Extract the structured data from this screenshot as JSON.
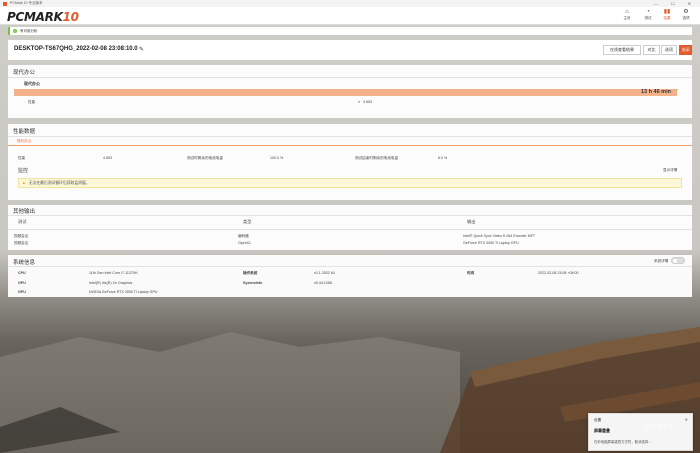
{
  "window": {
    "title": "PCMark 10 专业版本",
    "controls": "— ☐ ✕"
  },
  "header": {
    "logo_text": "PCMARK",
    "logo_num": "10",
    "nav": [
      {
        "label": "主页",
        "icon": "⌂"
      },
      {
        "label": "测试",
        "icon": "◔"
      },
      {
        "label": "结果",
        "icon": "▮▮"
      },
      {
        "label": "选项",
        "icon": "⚙"
      }
    ]
  },
  "notice": {
    "text": "有可用分析",
    "icon": "✓"
  },
  "result": {
    "name": "DESKTOP-TS67QHG_2022-02-08 23:08:10.0",
    "edit_icon": "✎",
    "buttons": {
      "compare": "在线查看结果",
      "compare2": "对比",
      "options": "选项",
      "close": "关闭"
    }
  },
  "modern": {
    "title": "现代办公",
    "bar_label": "现代办公",
    "time": "13 h 46 min",
    "status_icon": "✓",
    "row_label": "性能",
    "row_value": "4 653",
    "row_icon": "●"
  },
  "perf": {
    "title": "性能数据",
    "tab": "现代办公",
    "cells": {
      "c1": "性能",
      "v1": "4 653",
      "c2": "测试时剩余的电池电量",
      "v2": "100.0 %",
      "c3": "测试结束时剩余的电池电量",
      "v3": "6.0 %"
    },
    "monitor": "监控",
    "show_details": "显示详情",
    "warn": "无法在最后测试循环后获取监测值。"
  },
  "other": {
    "title": "其他输出",
    "cols": [
      "测试",
      "类型",
      "输出"
    ],
    "rows": [
      [
        "视频会议",
        "编码器",
        "Intel® Quick Sync Video H.264 Encoder MFT"
      ],
      [
        "视频会议",
        "OpenCL",
        "GeForce RTX 3050 Ti Laptop GPU"
      ]
    ]
  },
  "sysinfo": {
    "title": "系统信息",
    "toggle_label": "系统详情",
    "rows": [
      [
        "CPU",
        "11th Gen Intel Core i7-11370H",
        "操作系统",
        "v2.1.2532 64",
        "时间",
        "2022-02-08 23:08 +08:00"
      ],
      [
        "GPU",
        "Intel(R) Iris(R) Xe Graphics",
        "SystemInfo",
        "v5.44.1058",
        "",
        ""
      ],
      [
        "GPU",
        "NVIDIA GeForce RTX 3050 Ti Laptop GPU",
        "",
        "",
        "",
        ""
      ]
    ]
  },
  "toast": {
    "app": "设置",
    "title": "屏幕重叠",
    "body": "在你电脑屏幕重叠方式时，取消选择…",
    "close": "✕"
  },
  "watermark": "yesky",
  "colors": {
    "accent": "#e35a2b",
    "ok": "#75c443",
    "bar": "#f4b28a"
  }
}
